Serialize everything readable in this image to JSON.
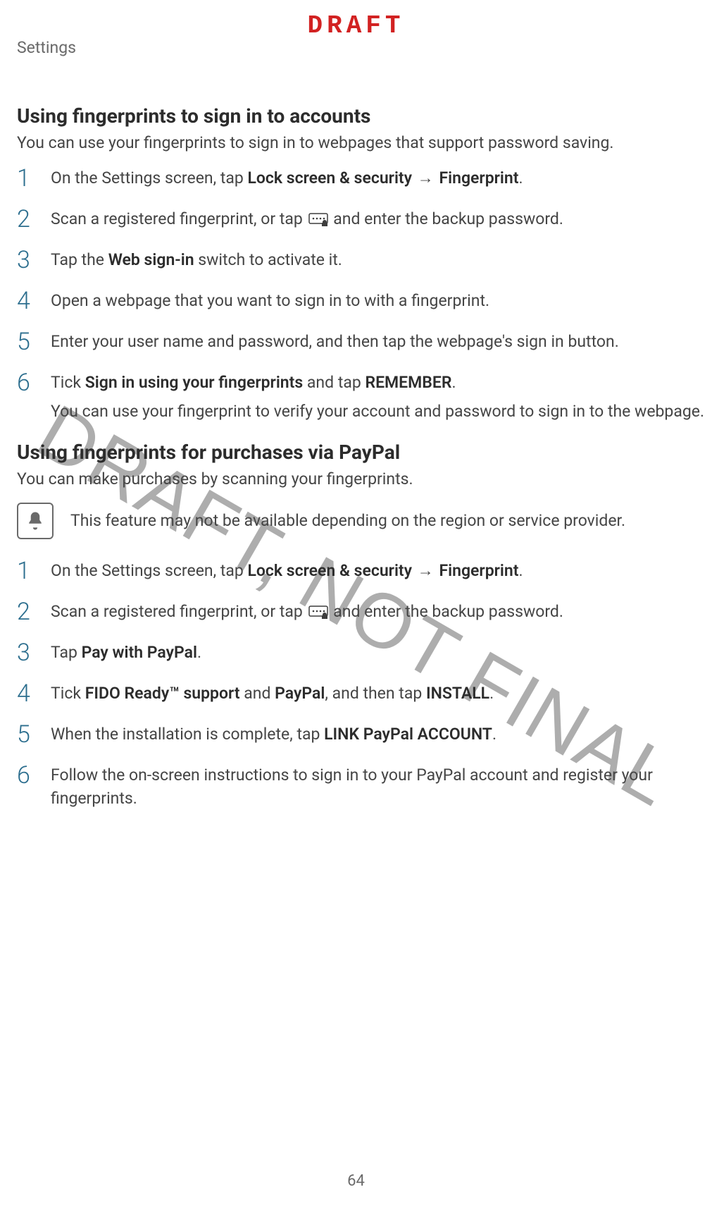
{
  "header": {
    "draft_label": "DRAFT",
    "breadcrumb": "Settings"
  },
  "watermark": "DRAFT, NOT FINAL",
  "page_number": "64",
  "section1": {
    "title": "Using fingerprints to sign in to accounts",
    "intro": "You can use your fingerprints to sign in to webpages that support password saving.",
    "steps": [
      {
        "n": "1",
        "pre": "On the Settings screen, tap ",
        "b1": "Lock screen & security",
        "arrow": " → ",
        "b2": "Fingerprint",
        "post": "."
      },
      {
        "n": "2",
        "pre": "Scan a registered fingerprint, or tap ",
        "post": " and enter the backup password."
      },
      {
        "n": "3",
        "pre": "Tap the ",
        "b1": "Web sign-in",
        "post": " switch to activate it."
      },
      {
        "n": "4",
        "pre": "Open a webpage that you want to sign in to with a fingerprint."
      },
      {
        "n": "5",
        "pre": "Enter your user name and password, and then tap the webpage's sign in button."
      },
      {
        "n": "6",
        "pre": "Tick ",
        "b1": "Sign in using your fingerprints",
        "mid": " and tap ",
        "b2": "REMEMBER",
        "post": ".",
        "sub": "You can use your fingerprint to verify your account and password to sign in to the webpage."
      }
    ]
  },
  "section2": {
    "title": "Using fingerprints for purchases via PayPal",
    "intro": "You can make purchases by scanning your fingerprints.",
    "callout": "This feature may not be available depending on the region or service provider.",
    "steps": [
      {
        "n": "1",
        "pre": "On the Settings screen, tap ",
        "b1": "Lock screen & security",
        "arrow": " → ",
        "b2": "Fingerprint",
        "post": "."
      },
      {
        "n": "2",
        "pre": "Scan a registered fingerprint, or tap ",
        "post": " and enter the backup password."
      },
      {
        "n": "3",
        "pre": "Tap ",
        "b1": "Pay with PayPal",
        "post": "."
      },
      {
        "n": "4",
        "pre": "Tick ",
        "b1": "FIDO Ready™ support",
        "mid": " and ",
        "b2": "PayPal",
        "mid2": ", and then tap ",
        "b3": "INSTALL",
        "post": "."
      },
      {
        "n": "5",
        "pre": "When the installation is complete, tap ",
        "b1": "LINK PayPal ACCOUNT",
        "post": "."
      },
      {
        "n": "6",
        "pre": "Follow the on-screen instructions to sign in to your PayPal account and register your fingerprints."
      }
    ]
  }
}
